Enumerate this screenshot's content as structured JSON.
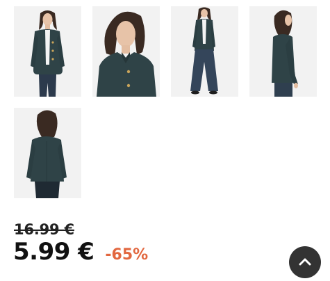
{
  "gallery": {
    "images": [
      {
        "view": "front"
      },
      {
        "view": "close-up"
      },
      {
        "view": "full-length"
      },
      {
        "view": "side"
      },
      {
        "view": "back"
      }
    ]
  },
  "pricing": {
    "old_price": "16.99 €",
    "new_price": "5.99 €",
    "discount": "-65%"
  },
  "colors": {
    "jacket": "#2f4347",
    "discount": "#e2673f",
    "scroll_button": "#333333"
  },
  "icons": {
    "scroll_top": "chevron-up-icon"
  }
}
